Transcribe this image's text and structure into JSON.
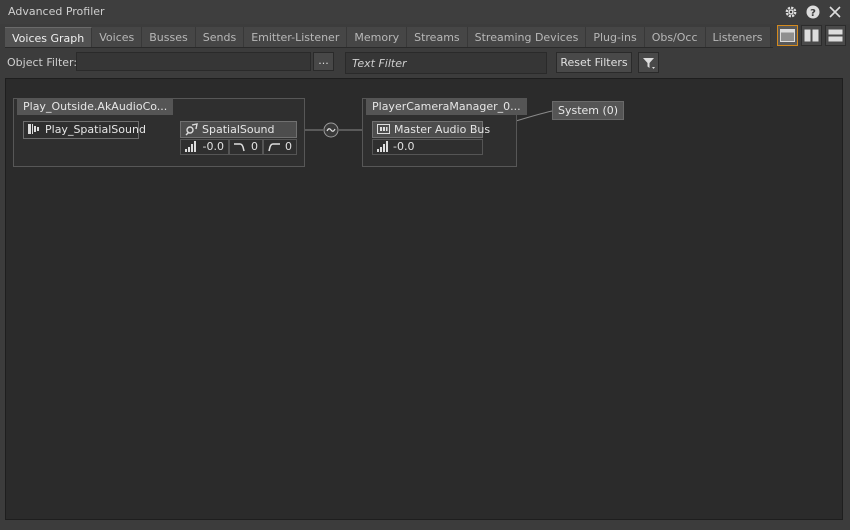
{
  "window": {
    "title": "Advanced Profiler"
  },
  "tabs": [
    {
      "label": "Voices Graph",
      "active": true
    },
    {
      "label": "Voices"
    },
    {
      "label": "Busses"
    },
    {
      "label": "Sends"
    },
    {
      "label": "Emitter-Listener"
    },
    {
      "label": "Memory"
    },
    {
      "label": "Streams"
    },
    {
      "label": "Streaming Devices"
    },
    {
      "label": "Plug-ins"
    },
    {
      "label": "Obs/Occ"
    },
    {
      "label": "Listeners"
    }
  ],
  "filters": {
    "object_filter_label": "Object Filter:",
    "object_filter_value": "",
    "browse_label": "...",
    "text_filter_placeholder": "Text Filter",
    "reset_label": "Reset Filters"
  },
  "graph": {
    "emitter_group": {
      "title": "Play_Outside.AkAudioCo...",
      "event_node": "Play_SpatialSound",
      "sound_node": "SpatialSound",
      "volume": "-0.0",
      "lpf": "0",
      "hpf": "0"
    },
    "listener_group": {
      "title": "PlayerCameraManager_0...",
      "bus_node": "Master Audio Bus",
      "volume": "-0.0"
    },
    "system_node": "System (0)"
  },
  "colors": {
    "accent": "#d48a1e",
    "canvas": "#2b2b2b",
    "panel": "#3c3c3c"
  }
}
